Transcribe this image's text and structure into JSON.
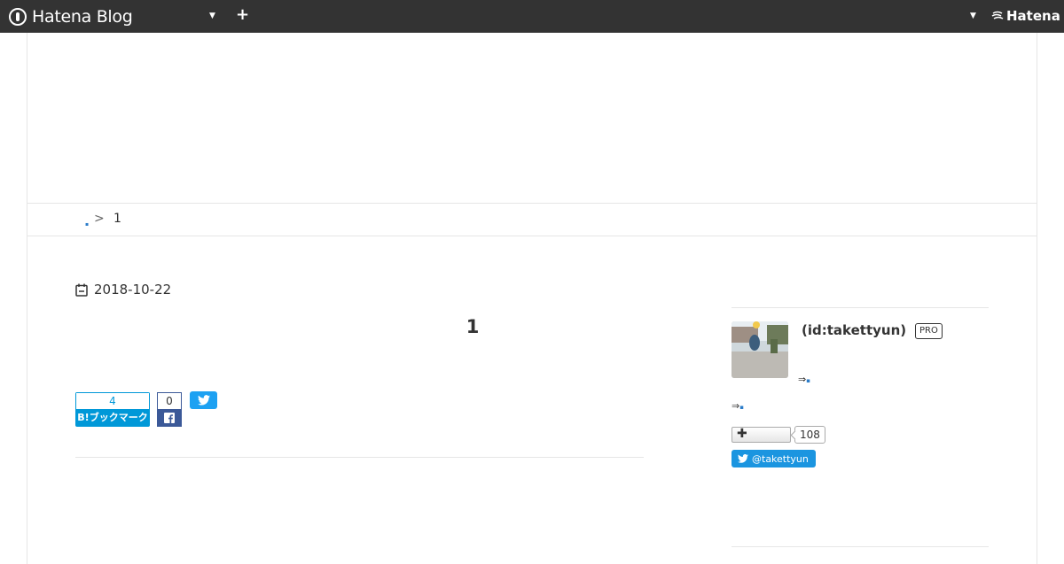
{
  "topbar": {
    "brand": "Hatena Blog",
    "add_label": "+",
    "hatena_label": "Hatena"
  },
  "breadcrumb": {
    "separator": ">",
    "current": "1"
  },
  "entry": {
    "date": "2018-10-22",
    "title": "1"
  },
  "share": {
    "hatena_bookmark_count": "4",
    "hatena_bookmark_label": "B!ブックマーク",
    "facebook_count": "0"
  },
  "profile": {
    "name": "(id:takettyun)",
    "badge": "PRO",
    "bio_line1": "⇒",
    "bio_line2": "⇒",
    "follower_count": "108",
    "twitter_handle": "@takettyun"
  },
  "colors": {
    "topbar": "#333333",
    "hatena_blue": "#0098d8",
    "facebook_blue": "#3b5998",
    "twitter_blue": "#1da1f2"
  }
}
